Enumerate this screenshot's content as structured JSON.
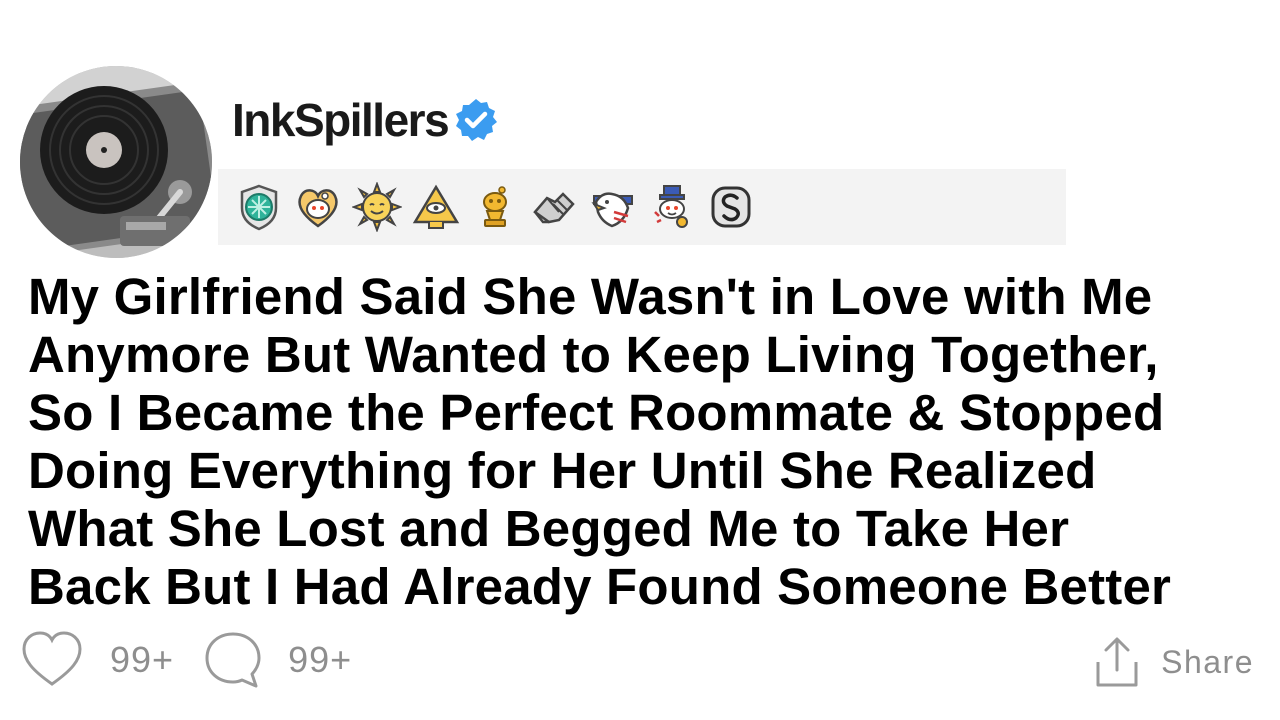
{
  "post": {
    "username": "InkSpillers",
    "title_lines": [
      "My Girlfriend Said She Wasn't in Love with Me",
      "Anymore But Wanted to Keep Living Together,",
      "So I Became the Perfect Roommate & Stopped",
      "Doing Everything for Her Until She Realized",
      "What She Lost and Begged Me to Take Her",
      "Back But I Had Already Found Someone Better"
    ]
  },
  "awards": [
    "gem-shield-award-icon",
    "heart-snoo-award-icon",
    "sun-face-award-icon",
    "pyramid-eye-award-icon",
    "gold-trophy-snoo-award-icon",
    "handshake-award-icon",
    "eagle-award-icon",
    "uncle-sam-snoo-award-icon",
    "silver-s-award-icon"
  ],
  "actions": {
    "likes": "99+",
    "comments": "99+",
    "share_label": "Share"
  },
  "colors": {
    "verified": "#3b9cf0",
    "muted": "#8e8e8e",
    "award_bar": "#f3f3f3"
  }
}
